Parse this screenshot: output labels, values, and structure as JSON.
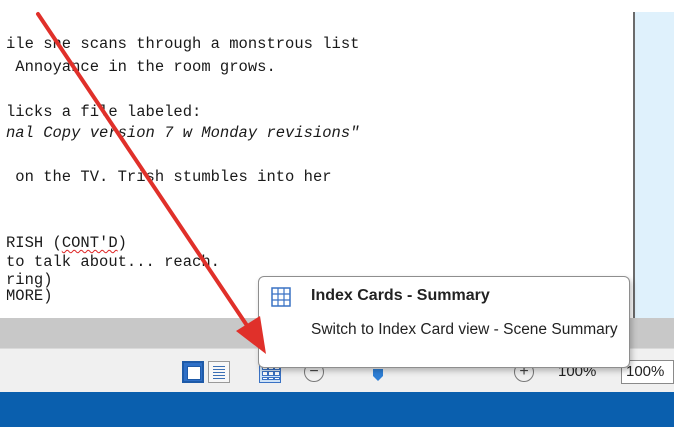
{
  "script": {
    "lines": [
      "ile she scans through a monstrous list",
      " Annoyance in the room grows.",
      "licks a file labeled:",
      "nal Copy version 7 w Monday revisions\"",
      " on the TV. Trish stumbles into her",
      "RISH (",
      "CONT'D",
      ")",
      "to talk about... reach.",
      "ring)",
      "MORE)"
    ]
  },
  "tooltip": {
    "icon": "grid-icon",
    "title": "Index Cards - Summary",
    "description": "Switch to Index Card view - Scene Summary"
  },
  "status_bar": {
    "view_buttons": [
      {
        "name": "normal-view-button",
        "icon": "normal-view-icon",
        "state": "active"
      },
      {
        "name": "page-view-button",
        "icon": "page-view-icon",
        "state": "inactive"
      },
      {
        "name": "index-cards-button",
        "icon": "grid-icon",
        "state": "hover"
      }
    ],
    "zoom": {
      "minus": "−",
      "plus": "+",
      "label": "100%",
      "value": "100%",
      "level": 0.28
    }
  },
  "annotation": {
    "color": "#e0302a"
  },
  "colors": {
    "accent": "#2e6fc7",
    "taskbar": "#0a5fae",
    "side_panel": "#dff1fc"
  }
}
